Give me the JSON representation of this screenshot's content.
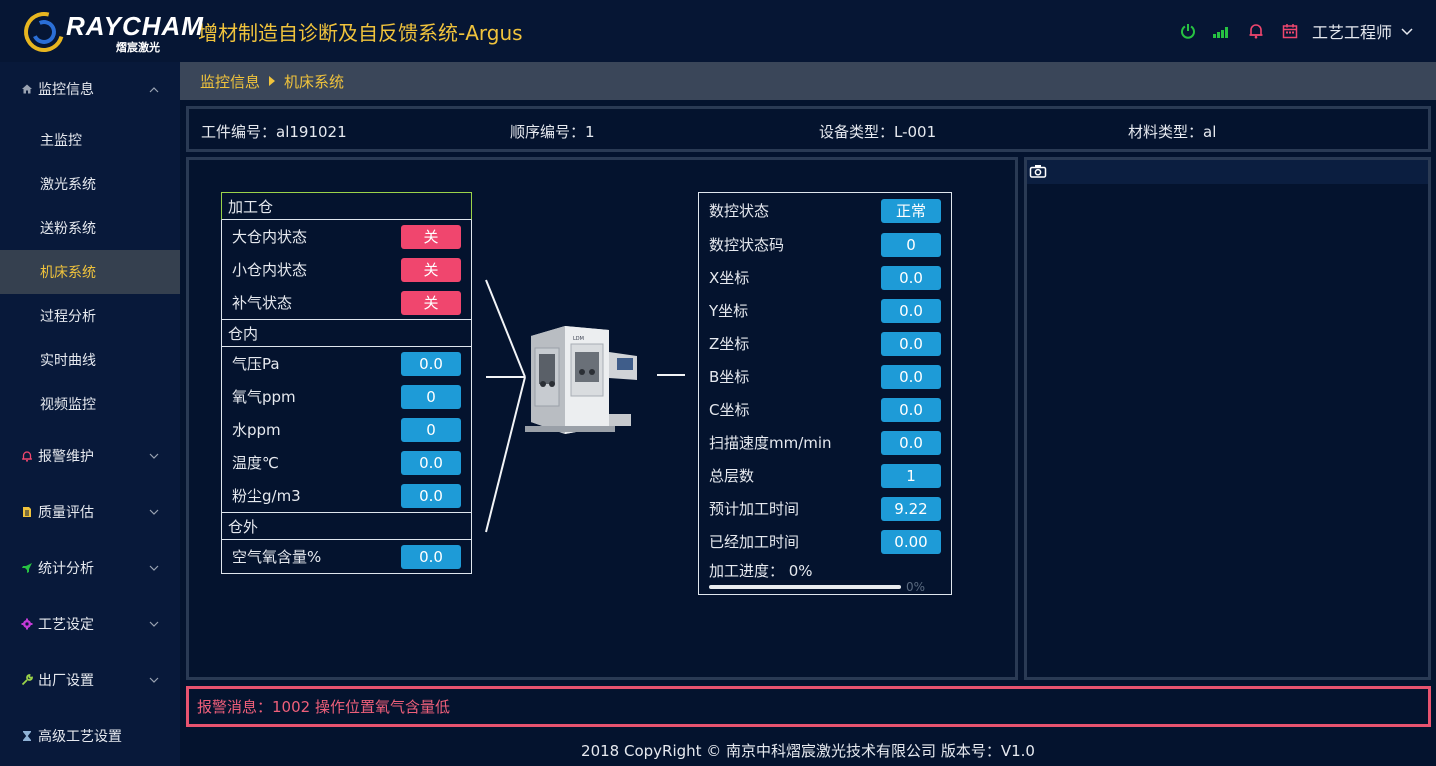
{
  "header": {
    "logo_text": "RAYCHAM",
    "logo_sub": "熠宸激光",
    "title": "增材制造自诊断及自反馈系统-Argus",
    "user": "工艺工程师",
    "icons": [
      "power-icon",
      "signal-icon",
      "bell-icon",
      "calendar-icon",
      "chevron-down-icon"
    ]
  },
  "sidebar": {
    "groups": [
      {
        "label": "监控信息",
        "icon": "home-icon",
        "expanded": true,
        "items": [
          "主监控",
          "激光系统",
          "送粉系统",
          "机床系统",
          "过程分析",
          "实时曲线",
          "视频监控"
        ],
        "active": "机床系统"
      },
      {
        "label": "报警维护",
        "icon": "bell-icon"
      },
      {
        "label": "质量评估",
        "icon": "document-icon"
      },
      {
        "label": "统计分析",
        "icon": "rocket-icon"
      },
      {
        "label": "工艺设定",
        "icon": "gear-icon"
      },
      {
        "label": "出厂设置",
        "icon": "wrench-icon"
      },
      {
        "label": "高级工艺设置",
        "icon": "hourglass-icon"
      }
    ]
  },
  "breadcrumb": {
    "parent": "监控信息",
    "current": "机床系统"
  },
  "info": {
    "workpiece": "工件编号：al191021",
    "sequence": "顺序编号：1",
    "device_type": "设备类型：L-001",
    "material": "材料类型：al"
  },
  "chamber": {
    "section1": "加工仓",
    "rows1": [
      {
        "label": "大仓内状态",
        "value": "关"
      },
      {
        "label": "小仓内状态",
        "value": "关"
      },
      {
        "label": "补气状态",
        "value": "关"
      }
    ],
    "section2": "仓内",
    "rows2": [
      {
        "label": "气压Pa",
        "value": "0.0"
      },
      {
        "label": "氧气ppm",
        "value": "0"
      },
      {
        "label": "水ppm",
        "value": "0"
      },
      {
        "label": "温度℃",
        "value": "0.0"
      },
      {
        "label": "粉尘g/m3",
        "value": "0.0"
      }
    ],
    "section3": "仓外",
    "rows3": [
      {
        "label": "空气氧含量%",
        "value": "0.0"
      }
    ]
  },
  "nc": {
    "rows": [
      {
        "label": "数控状态",
        "value": "正常"
      },
      {
        "label": "数控状态码",
        "value": "0"
      },
      {
        "label": "X坐标",
        "value": "0.0"
      },
      {
        "label": "Y坐标",
        "value": "0.0"
      },
      {
        "label": "Z坐标",
        "value": "0.0"
      },
      {
        "label": "B坐标",
        "value": "0.0"
      },
      {
        "label": "C坐标",
        "value": "0.0"
      },
      {
        "label": "扫描速度mm/min",
        "value": "0.0"
      },
      {
        "label": "总层数",
        "value": "1"
      },
      {
        "label": "预计加工时间",
        "value": "9.22"
      },
      {
        "label": "已经加工时间",
        "value": "0.00"
      }
    ],
    "progress_label": "加工进度：  0%",
    "progress_pct_text": "0%",
    "progress": 0
  },
  "machine_label": "LDM",
  "alarm": "报警消息：1002 操作位置氧气含量低",
  "footer": "2018 CopyRight © 南京中科熠宸激光技术有限公司 版本号：V1.0",
  "colors": {
    "background": "#04132e",
    "accent_yellow": "#f0c33c",
    "value_blue": "#1e9bd7",
    "state_red": "#f0466e",
    "alarm_red": "#e8536f"
  }
}
